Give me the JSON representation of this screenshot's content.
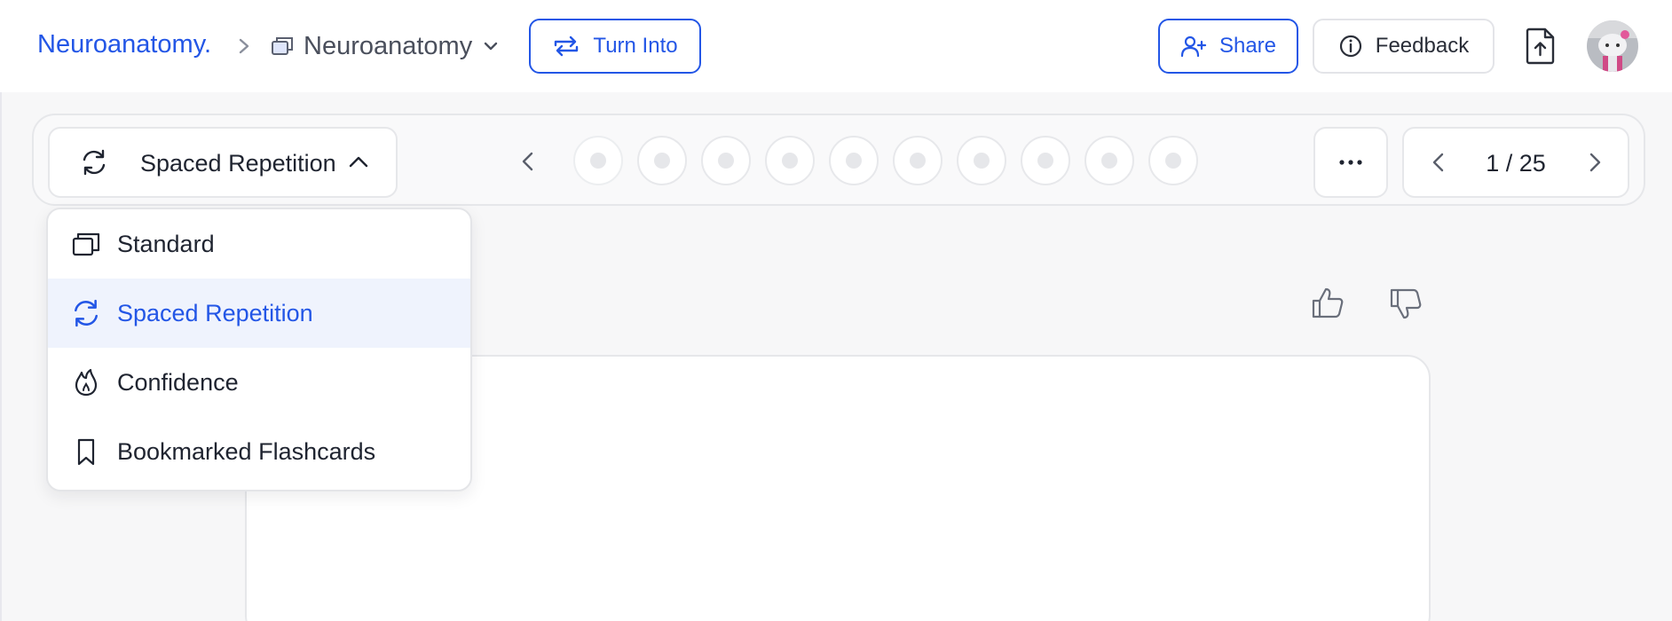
{
  "header": {
    "breadcrumb_root": "Neuroanatomy.",
    "breadcrumb_current": "Neuroanatomy",
    "turn_into_label": "Turn Into",
    "share_label": "Share",
    "feedback_label": "Feedback"
  },
  "toolbar": {
    "mode_selected": "Spaced Repetition",
    "progress_dot_count": 10,
    "pager": "1 / 25"
  },
  "mode_menu": {
    "items": [
      {
        "label": "Standard",
        "icon": "cards-icon",
        "selected": false
      },
      {
        "label": "Spaced Repetition",
        "icon": "refresh-icon",
        "selected": true
      },
      {
        "label": "Confidence",
        "icon": "flame-icon",
        "selected": false
      },
      {
        "label": "Bookmarked Flashcards",
        "icon": "bookmark-icon",
        "selected": false
      }
    ]
  },
  "colors": {
    "accent": "#2356e6",
    "selected_bg": "#eff3fd",
    "border": "#e6e7ea",
    "page_bg": "#f7f7f8"
  }
}
